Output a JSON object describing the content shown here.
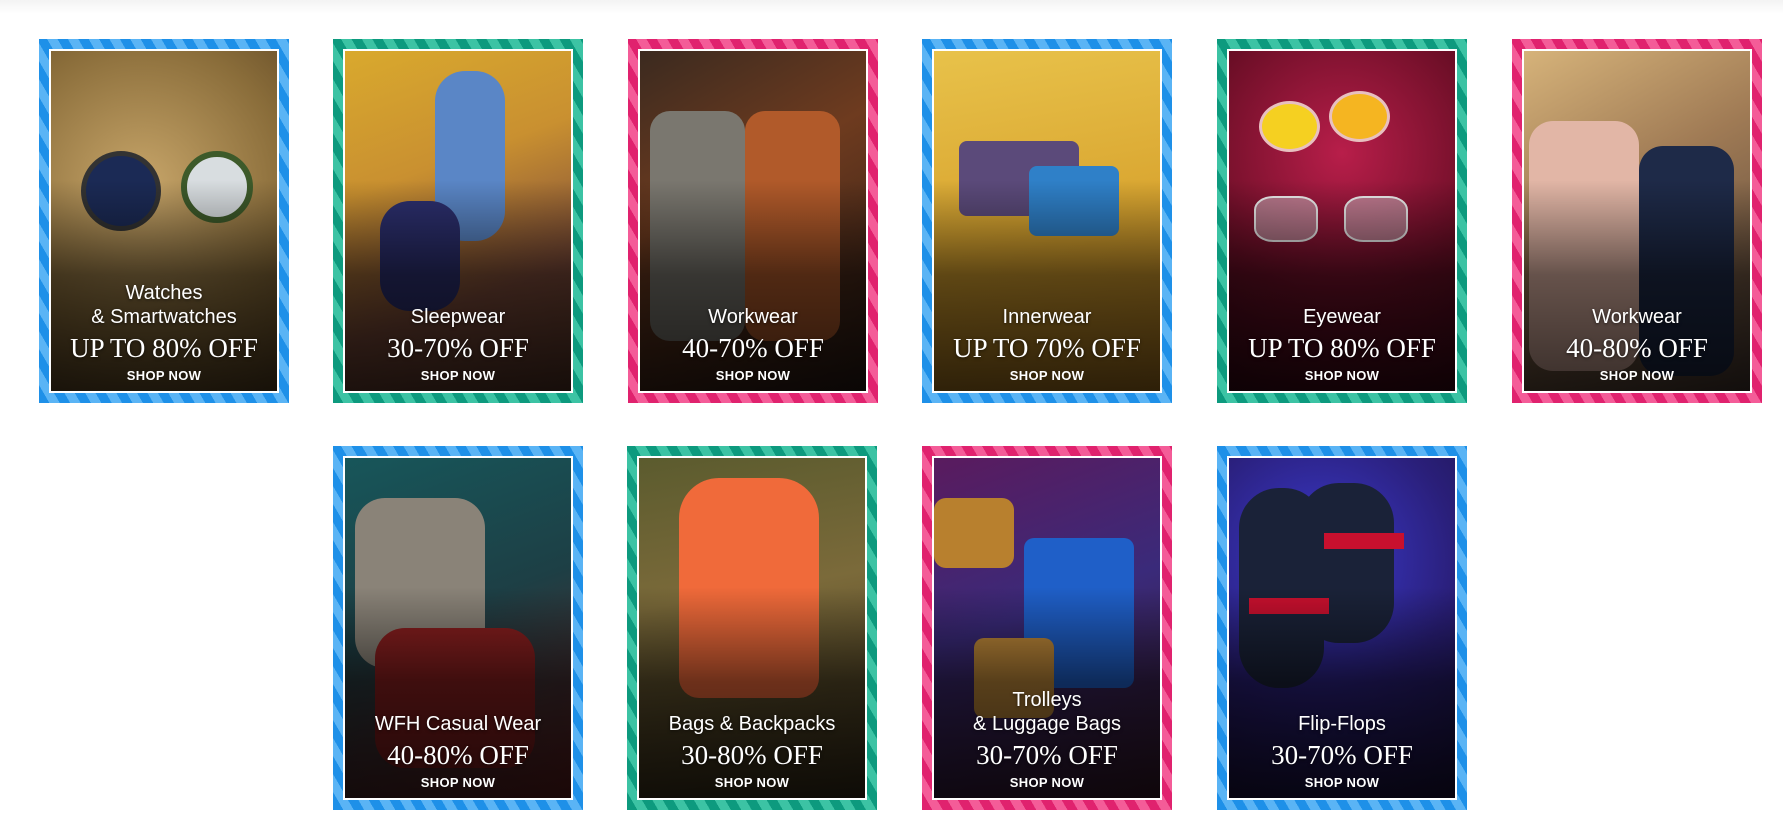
{
  "shop_label": "SHOP NOW",
  "cards": [
    {
      "category": "Watches\n& Smartwatches",
      "offer": "UP TO 80% OFF",
      "frame": "blue"
    },
    {
      "category": "Sleepwear",
      "offer": "30-70% OFF",
      "frame": "teal"
    },
    {
      "category": "Workwear",
      "offer": "40-70% OFF",
      "frame": "pink"
    },
    {
      "category": "Innerwear",
      "offer": "UP TO 70% OFF",
      "frame": "blue"
    },
    {
      "category": "Eyewear",
      "offer": "UP TO 80% OFF",
      "frame": "teal"
    },
    {
      "category": "Workwear",
      "offer": "40-80% OFF",
      "frame": "pink"
    },
    {
      "category": "WFH Casual Wear",
      "offer": "40-80% OFF",
      "frame": "blue"
    },
    {
      "category": "Bags & Backpacks",
      "offer": "30-80% OFF",
      "frame": "teal"
    },
    {
      "category": "Trolleys\n& Luggage Bags",
      "offer": "30-70% OFF",
      "frame": "pink"
    },
    {
      "category": "Flip-Flops",
      "offer": "30-70% OFF",
      "frame": "blue"
    }
  ],
  "colors": {
    "blue_frame": "#1e90e8",
    "teal_frame": "#0d9a7e",
    "pink_frame": "#e0226e"
  }
}
